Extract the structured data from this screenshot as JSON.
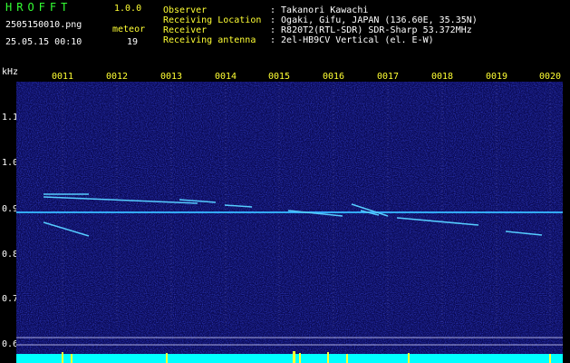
{
  "header": {
    "title": "HROFFT",
    "version": "1.0.0",
    "filename": "2505150010.png",
    "datetime": "25.05.15 00:10",
    "meteor_label": "meteor",
    "meteor_count": "19",
    "info": [
      {
        "key": "Observer",
        "value": ": Takanori Kawachi"
      },
      {
        "key": "Receiving Location",
        "value": ": Ogaki, Gifu, JAPAN (136.60E, 35.35N)"
      },
      {
        "key": "Receiver",
        "value": ": R820T2(RTL-SDR) SDR-Sharp 53.372MHz"
      },
      {
        "key": "Receiving antenna",
        "value": ": 2el-HB9CV Vertical (el. E-W)"
      }
    ]
  },
  "axis": {
    "unit": "kHz",
    "y_ticks": [
      "1.1",
      "1.0",
      "0.9",
      "0.8",
      "0.7",
      "0.6"
    ],
    "x_ticks": [
      "0011",
      "0012",
      "0013",
      "0014",
      "0015",
      "0016",
      "0017",
      "0018",
      "0019",
      "0020"
    ]
  },
  "colors": {
    "background": "#000000",
    "spectrogram": "#0a0a55",
    "carrier": "#33aaff",
    "baseline": "#00ffff",
    "text_green": "#33ff33",
    "text_yellow": "#ffff33"
  }
}
